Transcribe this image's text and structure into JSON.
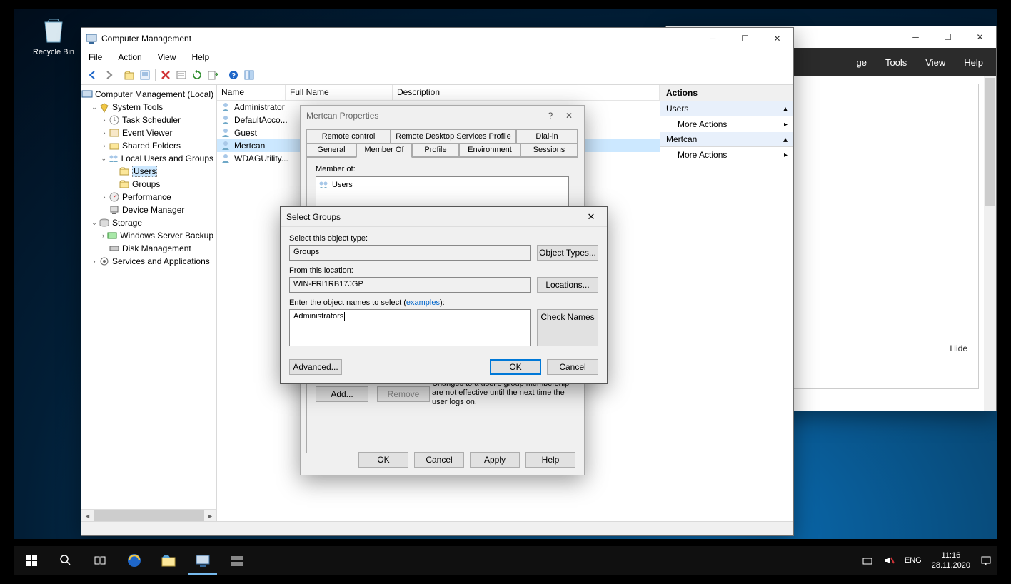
{
  "desktop": {
    "recycle_bin": "Recycle Bin"
  },
  "srvmgr": {
    "menus": {
      "ge": "ge",
      "tools": "Tools",
      "view": "View",
      "help": "Help"
    },
    "hide": "Hide"
  },
  "compmgmt": {
    "title": "Computer Management",
    "menus": {
      "file": "File",
      "action": "Action",
      "view": "View",
      "help": "Help"
    },
    "tree": {
      "root": "Computer Management (Local)",
      "system_tools": "System Tools",
      "task_scheduler": "Task Scheduler",
      "event_viewer": "Event Viewer",
      "shared_folders": "Shared Folders",
      "local_users": "Local Users and Groups",
      "users": "Users",
      "groups": "Groups",
      "performance": "Performance",
      "device_manager": "Device Manager",
      "storage": "Storage",
      "wsb": "Windows Server Backup",
      "disk_mgmt": "Disk Management",
      "svc_apps": "Services and Applications"
    },
    "list": {
      "cols": {
        "name": "Name",
        "full_name": "Full Name",
        "description": "Description"
      },
      "rows": [
        {
          "name": "Administrator"
        },
        {
          "name": "DefaultAcco..."
        },
        {
          "name": "Guest"
        },
        {
          "name": "Mertcan"
        },
        {
          "name": "WDAGUtility..."
        }
      ]
    },
    "actions": {
      "header": "Actions",
      "section1": "Users",
      "more1": "More Actions",
      "section2": "Mertcan",
      "more2": "More Actions"
    }
  },
  "propdlg": {
    "title": "Mertcan Properties",
    "tabs": {
      "remote_control": "Remote control",
      "rdsp": "Remote Desktop Services Profile",
      "dialin": "Dial-in",
      "general": "General",
      "member_of": "Member Of",
      "profile": "Profile",
      "environment": "Environment",
      "sessions": "Sessions"
    },
    "member_of_label": "Member of:",
    "members": [
      "Users"
    ],
    "note": "Changes to a user's group membership are not effective until the next time the user logs on.",
    "btn_add": "Add...",
    "btn_remove": "Remove",
    "btn_ok": "OK",
    "btn_cancel": "Cancel",
    "btn_apply": "Apply",
    "btn_help": "Help"
  },
  "selgroups": {
    "title": "Select Groups",
    "object_type_label": "Select this object type:",
    "object_type": "Groups",
    "btn_object_types": "Object Types...",
    "location_label": "From this location:",
    "location": "WIN-FRI1RB17JGP",
    "btn_locations": "Locations...",
    "names_label_1": "Enter the object names to select (",
    "names_label_link": "examples",
    "names_label_2": "):",
    "names_value": "Administrators",
    "btn_check": "Check Names",
    "btn_advanced": "Advanced...",
    "btn_ok": "OK",
    "btn_cancel": "Cancel"
  },
  "taskbar": {
    "lang": "ENG",
    "time": "11:16",
    "date": "28.11.2020"
  }
}
